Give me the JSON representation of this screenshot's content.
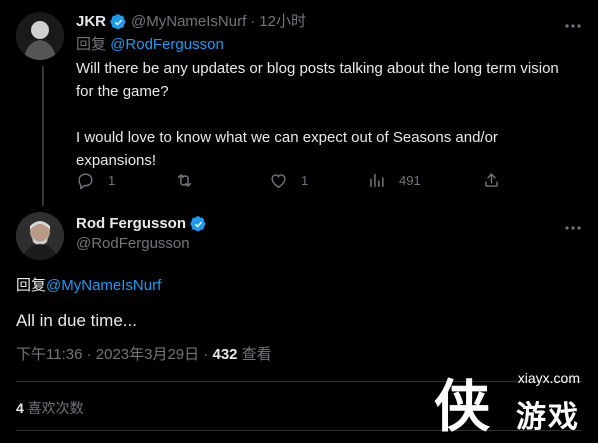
{
  "tweet1": {
    "name": "JKR",
    "handle": "@MyNameIsNurf",
    "sep": "·",
    "time": "12小时",
    "reply_prefix": "回复",
    "reply_handle": "@RodFergusson",
    "text_p1": "Will there be any updates or blog posts talking about the long term vision for the game?",
    "text_p2": "I would love to know what we can expect out of Seasons and/or expansions!",
    "actions": {
      "reply_count": "1",
      "retweet_count": "",
      "like_count": "1",
      "views_count": "491"
    }
  },
  "tweet2": {
    "name": "Rod Fergusson",
    "handle": "@RodFergusson",
    "reply_prefix": "回复",
    "reply_handle": "@MyNameIsNurf",
    "text": "All in due time...",
    "timestamp": "下午11:36 · 2023年3月29日 · ",
    "views_number": "432",
    "views_label": " 查看",
    "likes_number": "4",
    "likes_label": " 喜欢次数"
  },
  "watermark": {
    "site": "xiayx.com",
    "big_glyph": "侠",
    "text": "游戏"
  },
  "colors": {
    "background": "#000000",
    "link": "#1d9bf0",
    "secondary": "#71767b",
    "verified": "#1d9bf0"
  },
  "icons": [
    "more-icon",
    "verified-icon",
    "reply-icon",
    "retweet-icon",
    "like-icon",
    "views-icon",
    "share-icon"
  ]
}
